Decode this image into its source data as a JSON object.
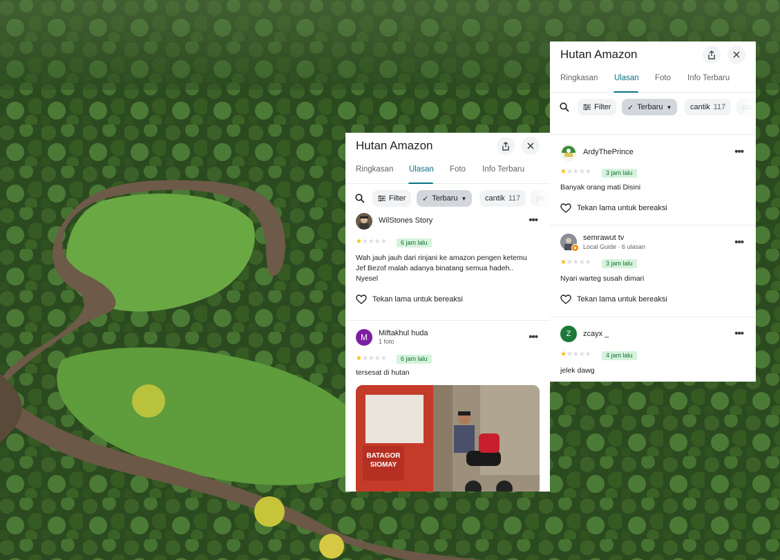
{
  "panels": [
    {
      "title": "Hutan Amazon",
      "tabs": [
        "Ringkasan",
        "Ulasan",
        "Foto",
        "Info Terbaru"
      ],
      "active_tab": "Ulasan",
      "filters": {
        "filter": "Filter",
        "sort": "Terbaru",
        "chip_label": "cantik",
        "chip_count": "117",
        "cut_chip": "par"
      },
      "reviews": [
        {
          "name": "WilStones Story",
          "sub": "",
          "rating": 1,
          "time": "6 jam lalu",
          "text": "Wah jauh jauh dari rinjani ke amazon pengen ketemu Jef Bezof malah adanya binatang semua hadeh.. Nyesel",
          "react": "Tekan lama untuk bereaksi"
        },
        {
          "name": "Miftakhul huda",
          "sub": "1 foto",
          "avatar_letter": "M",
          "rating": 1,
          "time": "6 jam lalu",
          "text": "tersesat di hutan",
          "photo_sign": [
            "BATAGOR",
            "SIOMAY"
          ]
        }
      ]
    },
    {
      "title": "Hutan Amazon",
      "tabs": [
        "Ringkasan",
        "Ulasan",
        "Foto",
        "Info Terbaru"
      ],
      "active_tab": "Ulasan",
      "filters": {
        "filter": "Filter",
        "sort": "Terbaru",
        "chip_label": "cantik",
        "chip_count": "117",
        "cut_chip": "par"
      },
      "reviews": [
        {
          "name": "ArdyThePrince",
          "sub": "",
          "rating": 1,
          "time": "3 jam lalu",
          "text": "Banyak orang mati Disini",
          "react": "Tekan lama untuk bereaksi"
        },
        {
          "name": "semrawut tv",
          "sub": "Local Guide · 6 ulasan",
          "rating": 1,
          "time": "3 jam lalu",
          "text": "Nyari warteg susah dimari",
          "react": "Tekan lama untuk bereaksi"
        },
        {
          "name": "zcayx _",
          "sub": "",
          "avatar_letter": "Z",
          "rating": 1,
          "time": "4 jam lalu",
          "text": "jelek dawg"
        }
      ]
    }
  ],
  "colors": {
    "accent": "#0b7285",
    "star": "#fbbc04",
    "time_bg": "#d6f2dc",
    "time_fg": "#137333"
  }
}
